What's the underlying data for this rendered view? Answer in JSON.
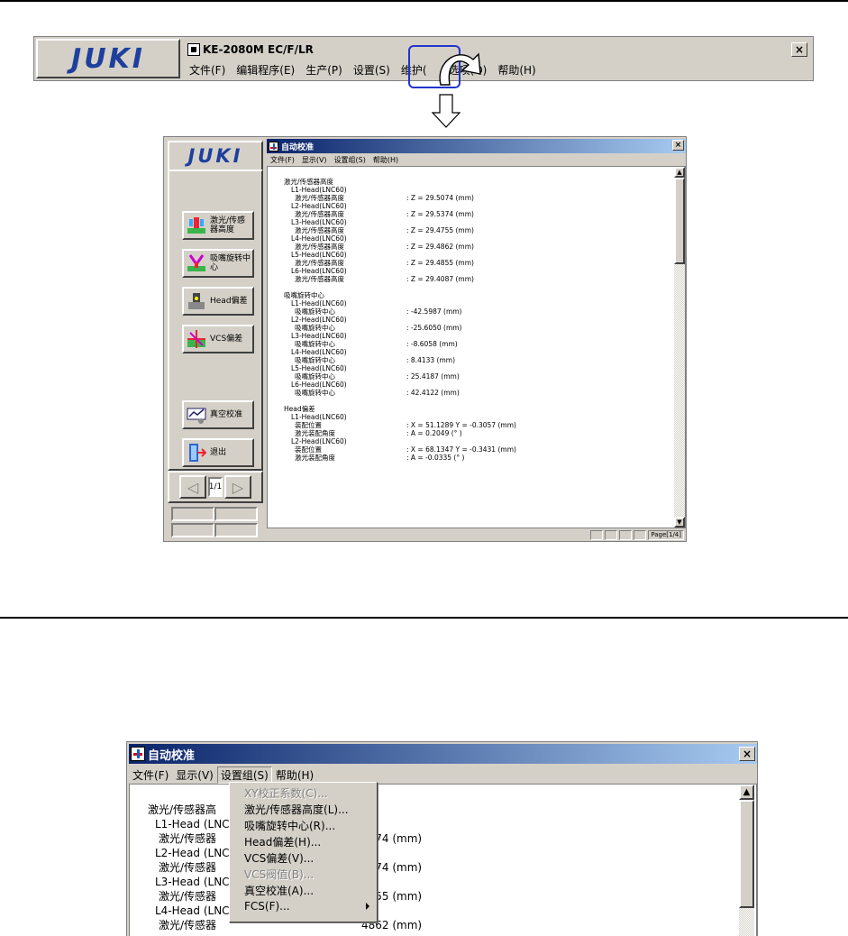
{
  "top_strip": {
    "logo": "JUKI",
    "title": "KE-2080M EC/F/LR",
    "close": "×",
    "menu": [
      "文件(F)",
      "编辑程序(E)",
      "生产(P)",
      "设置(S)",
      "维护(",
      "选项(O)",
      "帮助(H)"
    ]
  },
  "app1": {
    "logo": "JUKI",
    "title": "自动校准",
    "close": "×",
    "menu": [
      "文件(F)",
      "显示(V)",
      "设置组(S)",
      "帮助(H)"
    ],
    "side_buttons": [
      {
        "label": "激光/传感器高度",
        "icon": "laser-sensor-icon"
      },
      {
        "label": "吸嘴旋转中心",
        "icon": "nozzle-rotation-icon"
      },
      {
        "label": "Head偏差",
        "icon": "head-offset-icon"
      },
      {
        "label": "VCS偏差",
        "icon": "vcs-offset-icon"
      },
      {
        "label": "真空校准",
        "icon": "vacuum-icon"
      },
      {
        "label": "退出",
        "icon": "exit-icon"
      }
    ],
    "pager": {
      "prev": "◁",
      "page": "1/1",
      "next": "▷"
    },
    "status_page": "Page[1/4]",
    "sections": [
      {
        "heading": "激光/传感器高度",
        "entries": [
          {
            "head": "L1-Head(LNC60)",
            "label": "激光/传感器高度",
            "value": ": Z = 29.5074 (mm)"
          },
          {
            "head": "L2-Head(LNC60)",
            "label": "激光/传感器高度",
            "value": ": Z = 29.5374 (mm)"
          },
          {
            "head": "L3-Head(LNC60)",
            "label": "激光/传感器高度",
            "value": ": Z = 29.4755 (mm)"
          },
          {
            "head": "L4-Head(LNC60)",
            "label": "激光/传感器高度",
            "value": ": Z = 29.4862 (mm)"
          },
          {
            "head": "L5-Head(LNC60)",
            "label": "激光/传感器高度",
            "value": ": Z = 29.4855 (mm)"
          },
          {
            "head": "L6-Head(LNC60)",
            "label": "激光/传感器高度",
            "value": ": Z = 29.4087 (mm)"
          }
        ]
      },
      {
        "heading": "吸嘴旋转中心",
        "entries": [
          {
            "head": "L1-Head(LNC60)",
            "label": "吸嘴旋转中心",
            "value": ": -42.5987 (mm)"
          },
          {
            "head": "L2-Head(LNC60)",
            "label": "吸嘴旋转中心",
            "value": ": -25.6050 (mm)"
          },
          {
            "head": "L3-Head(LNC60)",
            "label": "吸嘴旋转中心",
            "value": ": -8.6058 (mm)"
          },
          {
            "head": "L4-Head(LNC60)",
            "label": "吸嘴旋转中心",
            "value": ": 8.4133 (mm)"
          },
          {
            "head": "L5-Head(LNC60)",
            "label": "吸嘴旋转中心",
            "value": ": 25.4187 (mm)"
          },
          {
            "head": "L6-Head(LNC60)",
            "label": "吸嘴旋转中心",
            "value": ": 42.4122 (mm)"
          }
        ]
      }
    ],
    "head_offset": {
      "heading": "Head偏差",
      "l1_head": "L1-Head(LNC60)",
      "l1_pos_label": "装配位置",
      "l1_pos_value": ": X = 51.1289 Y = -0.3057 (mm)",
      "l1_angle_label": "激光装配角度",
      "l1_angle_value": ": A = 0.2049 (° )",
      "l2_head": "L2-Head(LNC60)",
      "l2_pos_label": "装配位置",
      "l2_pos_value": ": X = 68.1347 Y = -0.3431 (mm)",
      "l2_angle_label": "激光装配角度",
      "l2_angle_value": ": A = -0.0335 (° )"
    }
  },
  "app2": {
    "title": "自动校准",
    "close": "×",
    "menu": [
      "文件(F)",
      "显示(V)",
      "设置组(S)",
      "帮助(H)"
    ],
    "content": {
      "heading": "激光/传感器高",
      "rows": [
        {
          "head": "L1-Head (LNC",
          "label": "激光/传感器",
          "value": "5074 (mm)"
        },
        {
          "head": "L2-Head (LNC",
          "label": "激光/传感器",
          "value": "5374 (mm)"
        },
        {
          "head": "L3-Head (LNC",
          "label": "激光/传感器",
          "value": "4755 (mm)"
        },
        {
          "head": "L4-Head (LNC",
          "label": "激光/传感器",
          "value": "4862 (mm)"
        }
      ]
    },
    "dropdown": [
      {
        "label": "XY校正系数(C)...",
        "disabled": true
      },
      {
        "label": "激光/传感器高度(L)...",
        "disabled": false
      },
      {
        "label": "吸嘴旋转中心(R)...",
        "disabled": false
      },
      {
        "label": "Head偏差(H)...",
        "disabled": false
      },
      {
        "label": "VCS偏差(V)...",
        "disabled": false
      },
      {
        "label": "VCS阀值(B)...",
        "disabled": true
      },
      {
        "label": "真空校准(A)...",
        "disabled": false
      },
      {
        "label": "FCS(F)...",
        "disabled": false,
        "submenu": true
      }
    ]
  }
}
